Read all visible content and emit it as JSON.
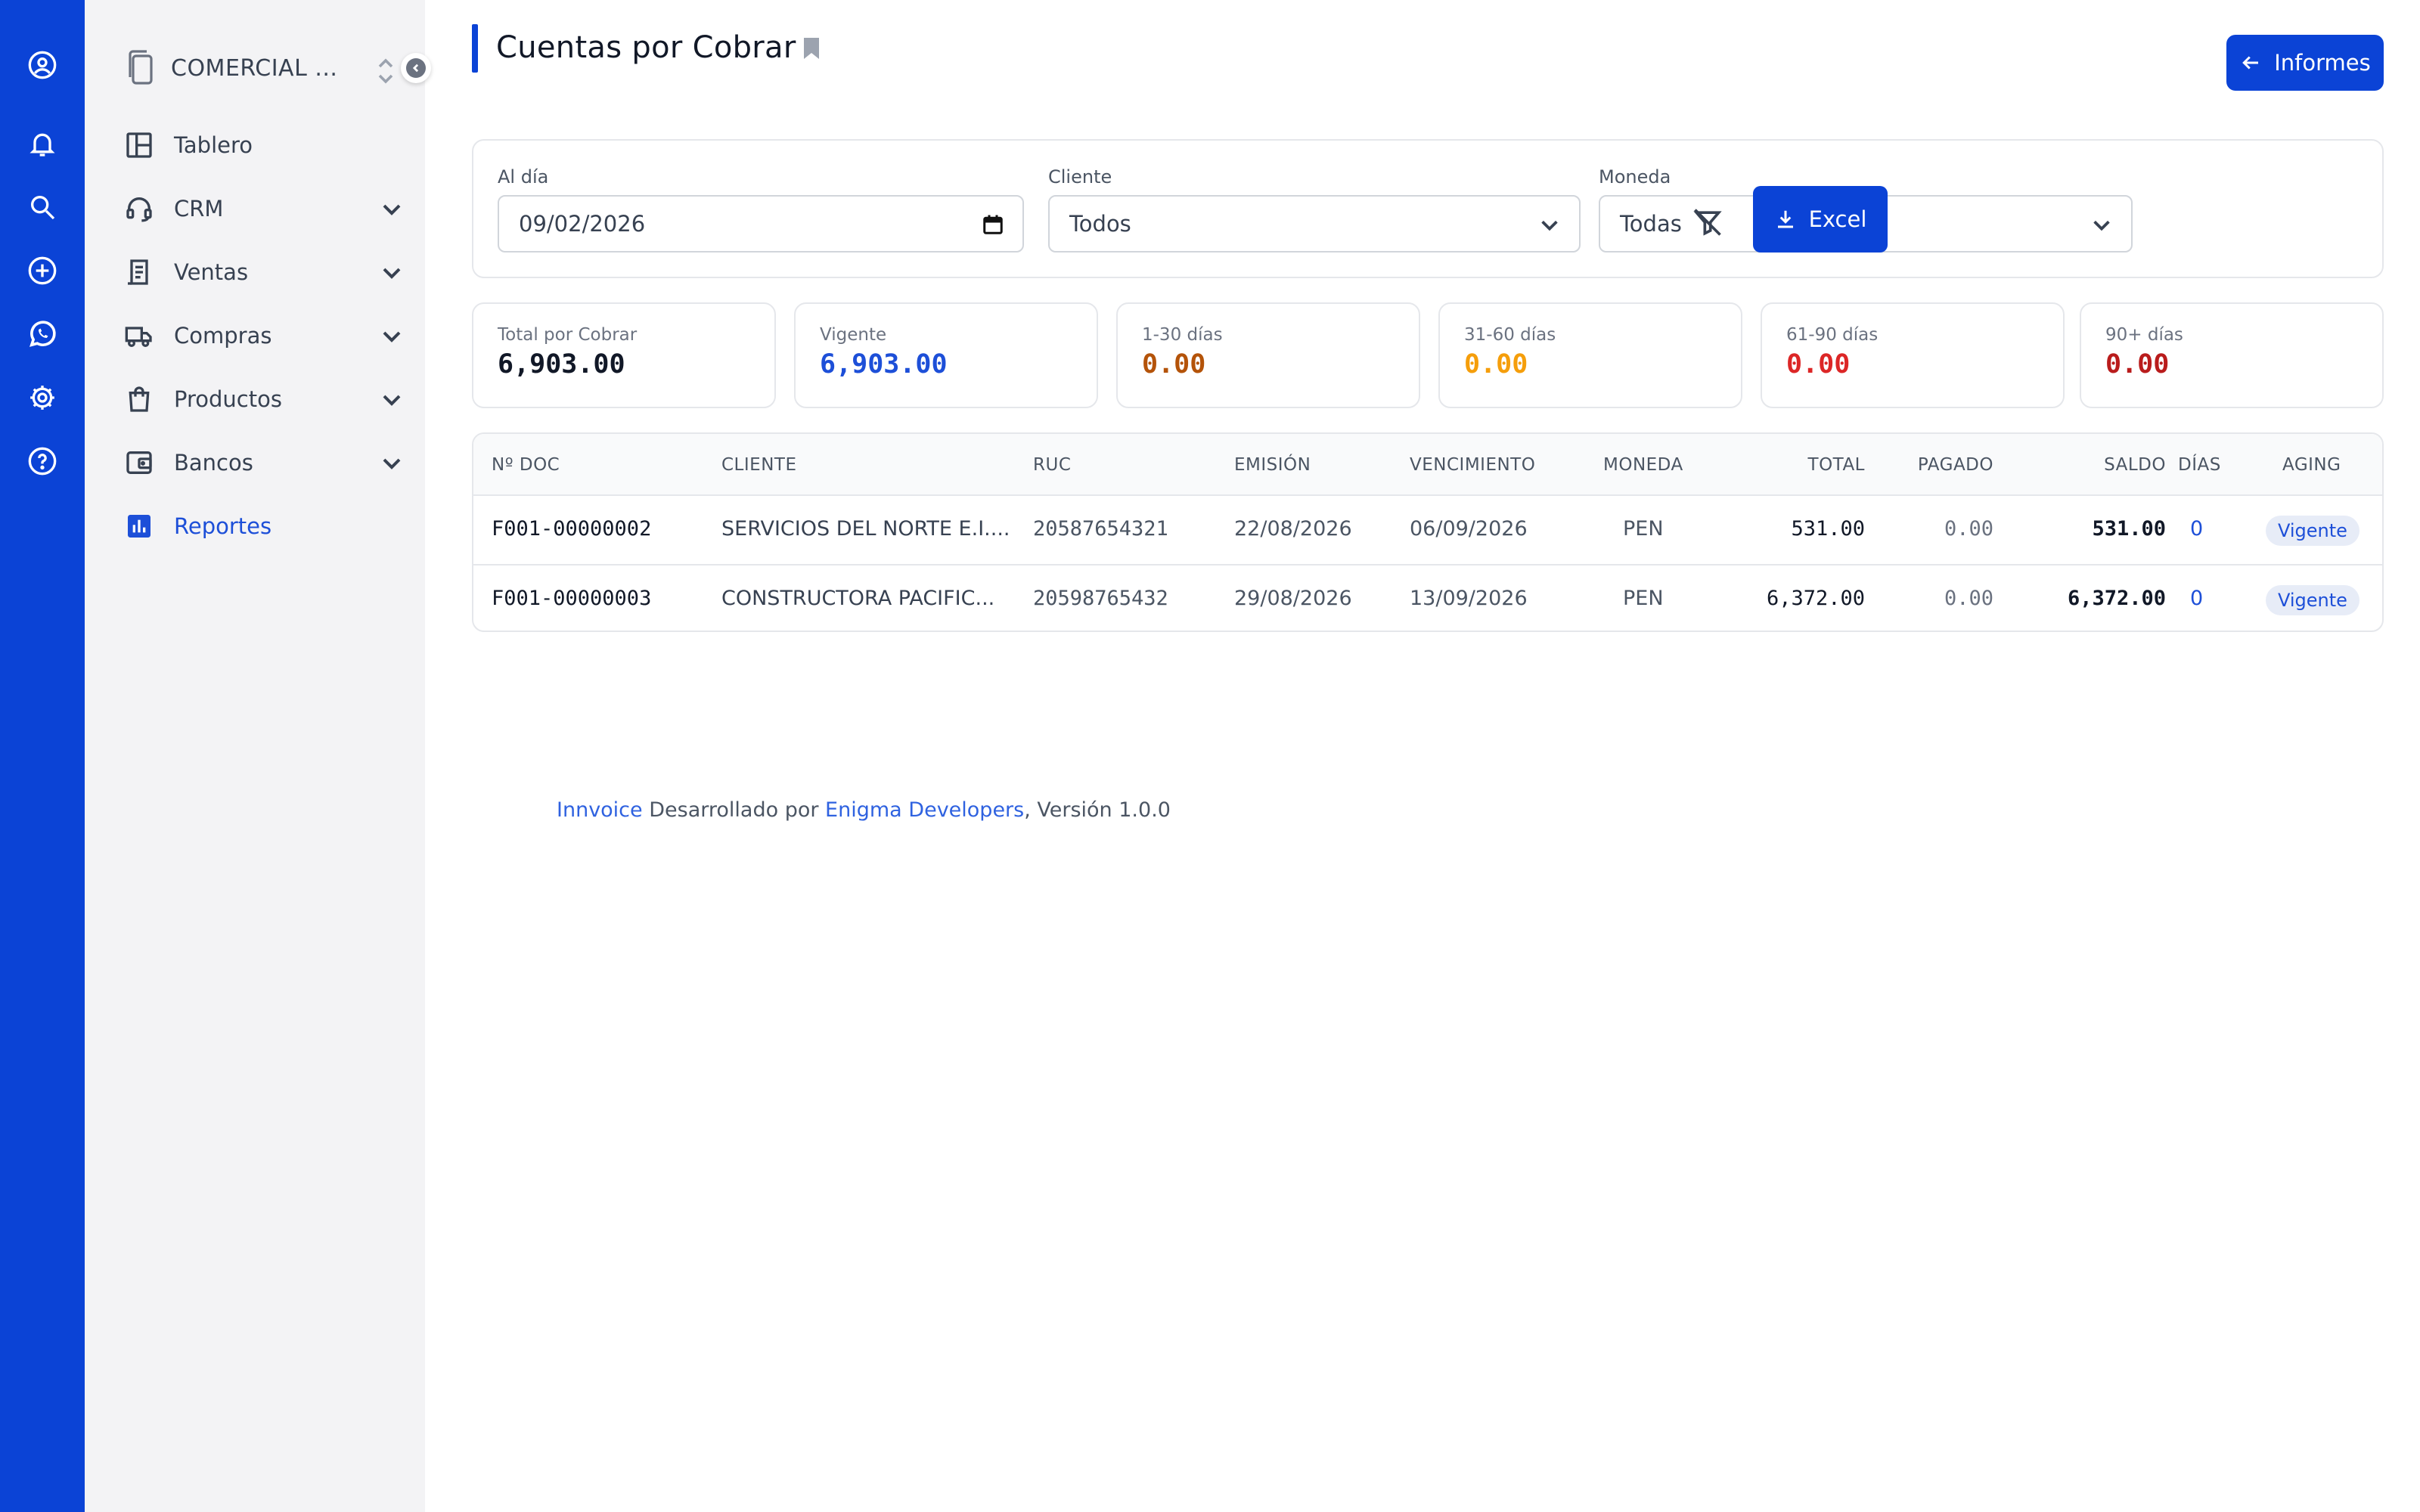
{
  "rail": {
    "icons": [
      "user-circle-icon",
      "bell-icon",
      "search-icon",
      "plus-circle-icon",
      "whatsapp-icon",
      "gear-icon",
      "help-circle-icon"
    ]
  },
  "sidebar": {
    "company": "COMERCIAL ...",
    "items": [
      {
        "label": "Tablero",
        "icon": "dashboard-icon",
        "has_children": false,
        "active": false
      },
      {
        "label": "CRM",
        "icon": "headset-icon",
        "has_children": true,
        "active": false
      },
      {
        "label": "Ventas",
        "icon": "receipt-icon",
        "has_children": true,
        "active": false
      },
      {
        "label": "Compras",
        "icon": "truck-icon",
        "has_children": true,
        "active": false
      },
      {
        "label": "Productos",
        "icon": "shopping-bag-icon",
        "has_children": true,
        "active": false
      },
      {
        "label": "Bancos",
        "icon": "wallet-icon",
        "has_children": true,
        "active": false
      },
      {
        "label": "Reportes",
        "icon": "bar-chart-icon",
        "has_children": false,
        "active": true
      }
    ]
  },
  "header": {
    "title": "Cuentas por Cobrar",
    "informes_label": "Informes"
  },
  "filters": {
    "date_label": "Al día",
    "date_value": "09/02/2026",
    "client_label": "Cliente",
    "client_value": "Todos",
    "currency_label": "Moneda",
    "currency_value": "Todas",
    "excel_label": "Excel"
  },
  "stats": [
    {
      "label": "Total por Cobrar",
      "value": "6,903.00",
      "color": "#111827"
    },
    {
      "label": "Vigente",
      "value": "6,903.00",
      "color": "#1d4fd8"
    },
    {
      "label": "1-30 días",
      "value": "0.00",
      "color": "#b45309"
    },
    {
      "label": "31-60 días",
      "value": "0.00",
      "color": "#f59e0b"
    },
    {
      "label": "61-90 días",
      "value": "0.00",
      "color": "#dc2626"
    },
    {
      "label": "90+ días",
      "value": "0.00",
      "color": "#b91c1c"
    }
  ],
  "table": {
    "columns": [
      "Nº DOC",
      "CLIENTE",
      "RUC",
      "EMISIÓN",
      "VENCIMIENTO",
      "MONEDA",
      "TOTAL",
      "PAGADO",
      "SALDO",
      "DÍAS",
      "AGING"
    ],
    "rows": [
      {
        "doc": "F001-00000002",
        "cliente": "SERVICIOS DEL NORTE E.I....",
        "ruc": "20587654321",
        "emision": "22/08/2026",
        "vencimiento": "06/09/2026",
        "moneda": "PEN",
        "total": "531.00",
        "pagado": "0.00",
        "saldo": "531.00",
        "dias": "0",
        "aging": "Vigente"
      },
      {
        "doc": "F001-00000003",
        "cliente": "CONSTRUCTORA PACIFIC...",
        "ruc": "20598765432",
        "emision": "29/08/2026",
        "vencimiento": "13/09/2026",
        "moneda": "PEN",
        "total": "6,372.00",
        "pagado": "0.00",
        "saldo": "6,372.00",
        "dias": "0",
        "aging": "Vigente"
      }
    ]
  },
  "footer": {
    "product": "Innvoice",
    "middle": " Desarrollado por ",
    "company": "Enigma Developers",
    "version": ", Versión 1.0.0"
  }
}
